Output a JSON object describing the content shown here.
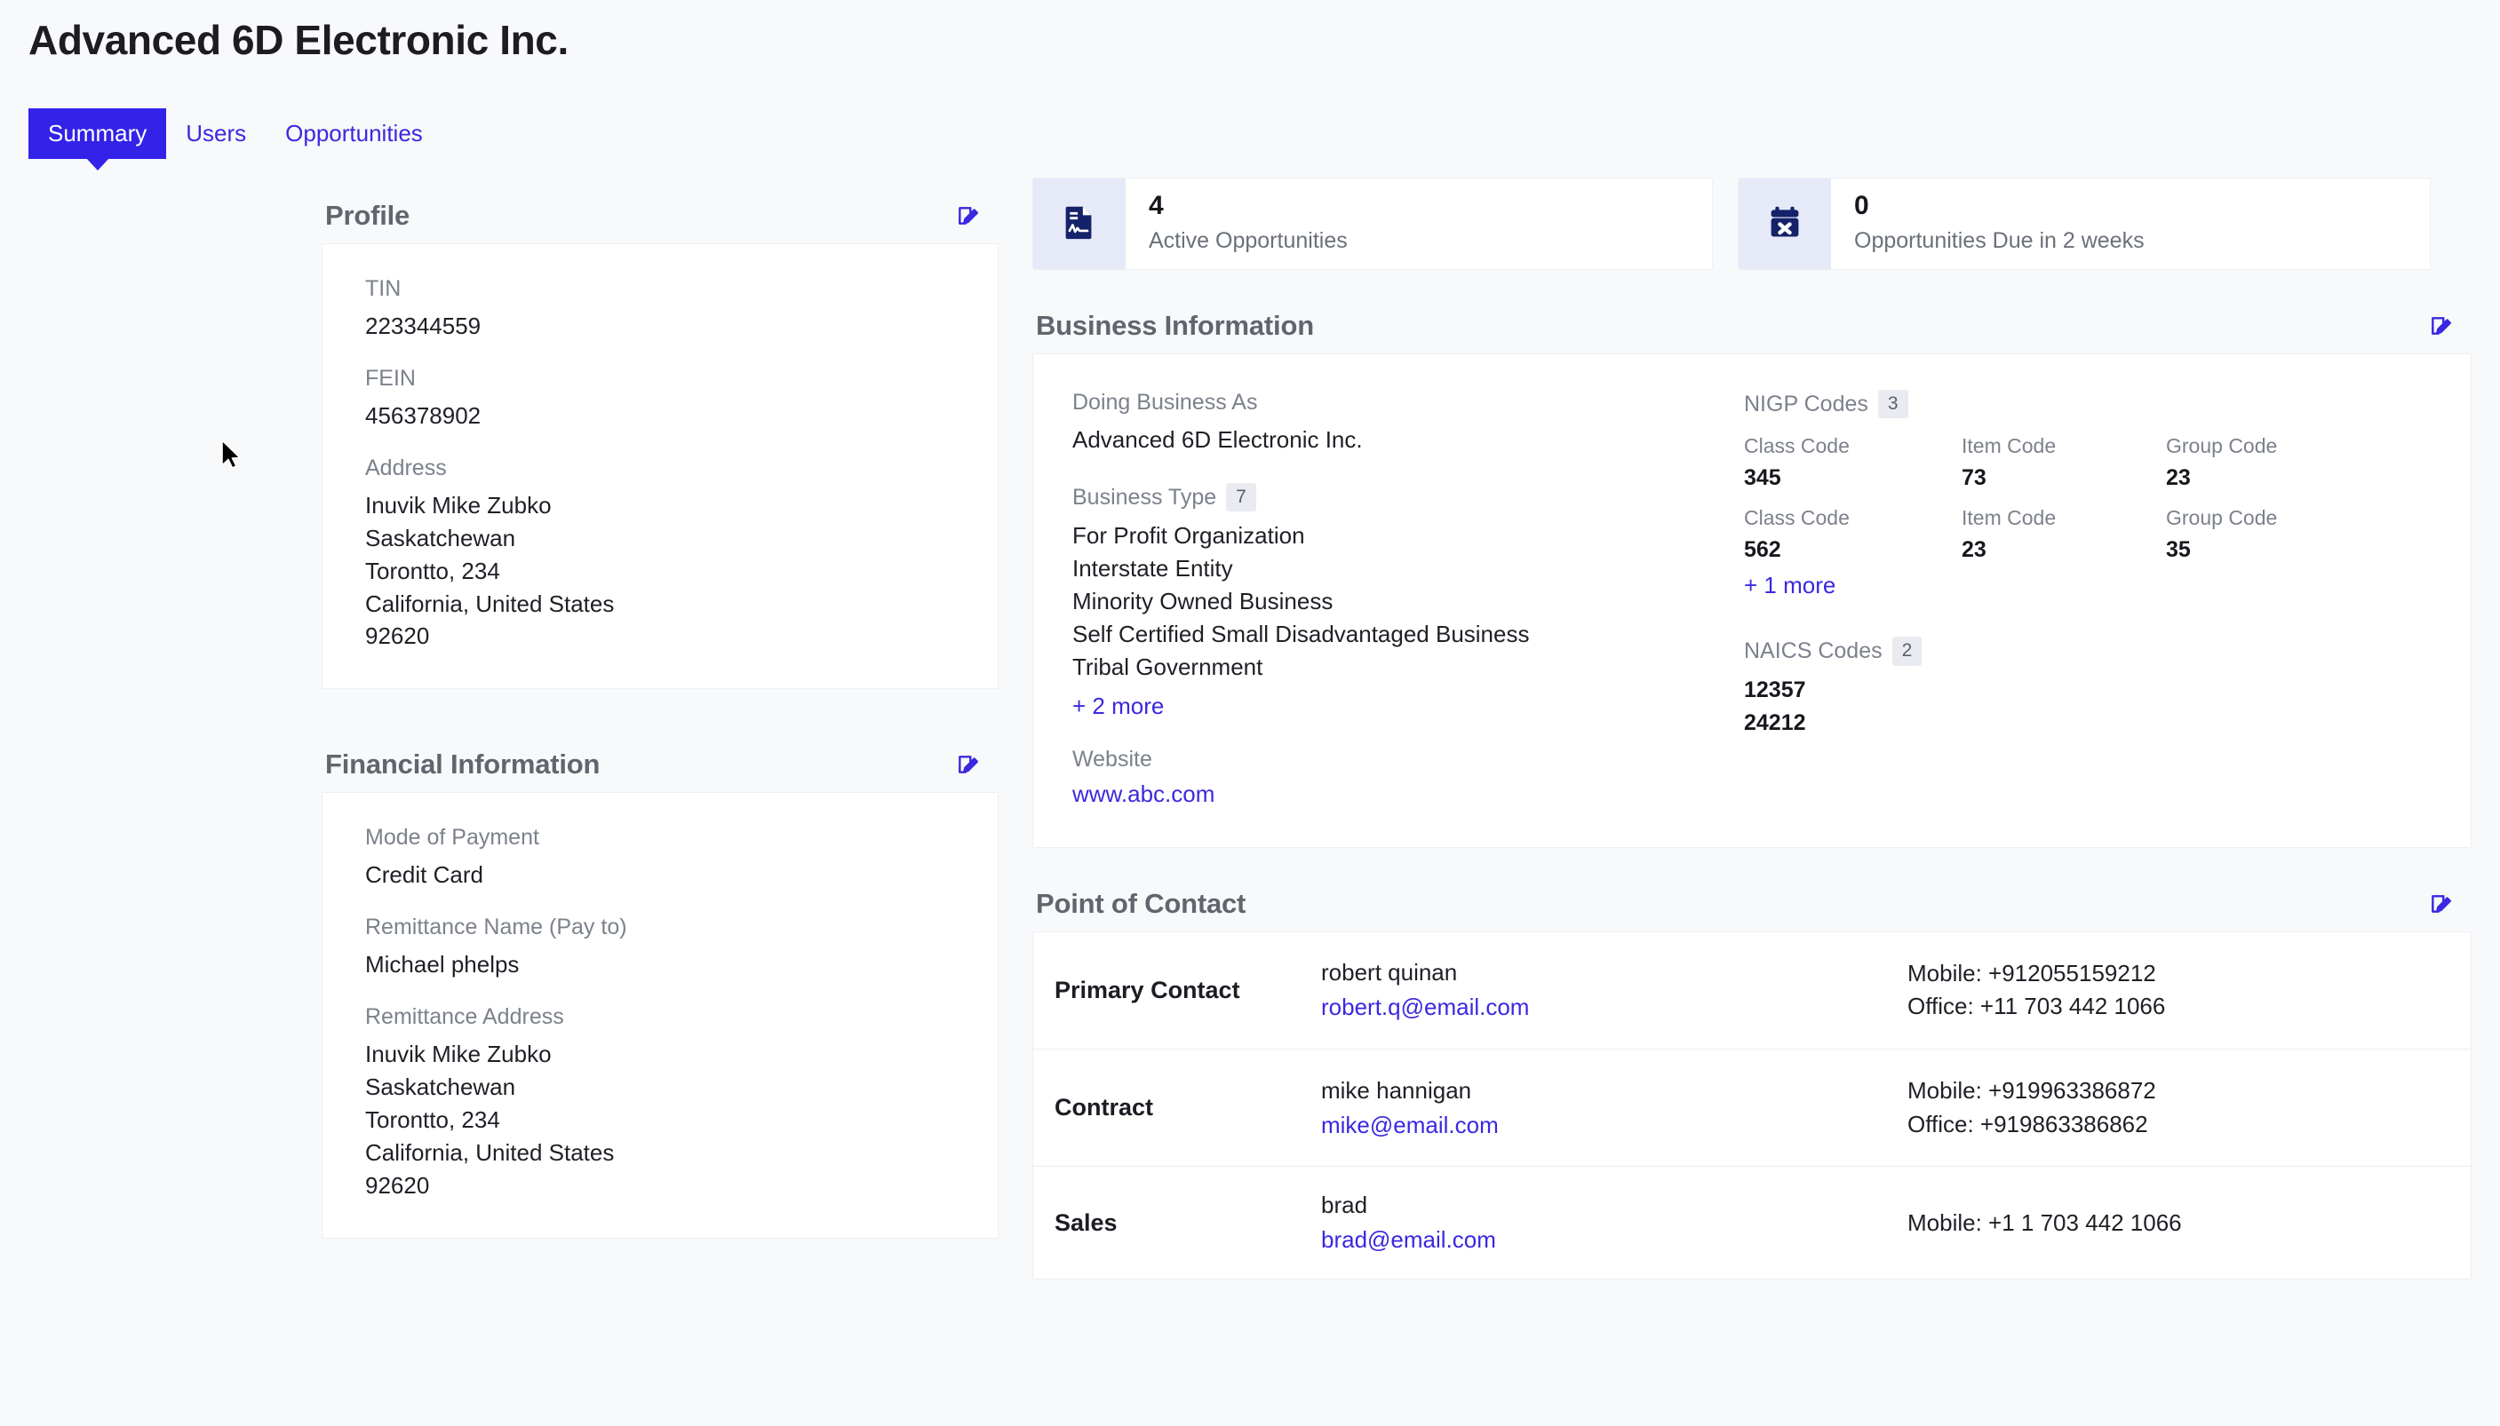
{
  "page": {
    "title": "Advanced 6D Electronic Inc."
  },
  "tabs": [
    {
      "label": "Summary",
      "active": true
    },
    {
      "label": "Users",
      "active": false
    },
    {
      "label": "Opportunities",
      "active": false
    }
  ],
  "colors": {
    "accent": "#3322E8",
    "link": "#3B28E0",
    "icon_navy": "#152269",
    "icon_bg": "#E6EAF8",
    "page_bg": "#F8F9FB",
    "card_bg": "#FFFFFF",
    "label_gray": "#7C818C",
    "heading_gray": "#61656E"
  },
  "profile": {
    "heading": "Profile",
    "edit_icon": "edit-pencil-icon",
    "fields": [
      {
        "label": "TIN",
        "value": "223344559"
      },
      {
        "label": "FEIN",
        "value": "456378902"
      },
      {
        "label": "Address",
        "value": "Inuvik Mike Zubko\nSaskatchewan\nTorontto, 234\nCalifornia, United States\n92620"
      }
    ]
  },
  "financial": {
    "heading": "Financial Information",
    "edit_icon": "edit-pencil-icon",
    "fields": [
      {
        "label": "Mode of Payment",
        "value": "Credit Card"
      },
      {
        "label": "Remittance Name (Pay to)",
        "value": "Michael phelps"
      },
      {
        "label": "Remittance Address",
        "value": "Inuvik Mike Zubko\nSaskatchewan\nTorontto, 234\nCalifornia, United States\n92620"
      }
    ]
  },
  "stats": [
    {
      "icon": "document-pulse-icon",
      "value": "4",
      "caption": "Active Opportunities"
    },
    {
      "icon": "calendar-x-icon",
      "value": "0",
      "caption": "Opportunities Due in 2 weeks"
    }
  ],
  "business": {
    "heading": "Business Information",
    "edit_icon": "edit-pencil-icon",
    "dba_label": "Doing Business As",
    "dba_value": "Advanced 6D Electronic Inc.",
    "business_type_label": "Business Type",
    "business_type_count": "7",
    "business_types": [
      "For Profit Organization",
      "Interstate Entity",
      "Minority Owned Business",
      "Self Certified Small Disadvantaged Business",
      "Tribal Government"
    ],
    "business_types_more": "+ 2 more",
    "website_label": "Website",
    "website_value": "www.abc.com",
    "nigp": {
      "label": "NIGP Codes",
      "count": "3",
      "col_labels": {
        "class": "Class Code",
        "item": "Item Code",
        "group": "Group Code"
      },
      "rows": [
        {
          "class": "345",
          "item": "73",
          "group": "23"
        },
        {
          "class": "562",
          "item": "23",
          "group": "35"
        }
      ],
      "more": "+ 1 more"
    },
    "naics": {
      "label": "NAICS Codes",
      "count": "2",
      "values": "12357\n24212"
    }
  },
  "contacts": {
    "heading": "Point of Contact",
    "edit_icon": "edit-pencil-icon",
    "rows": [
      {
        "role": "Primary Contact",
        "name": "robert quinan",
        "email": "robert.q@email.com",
        "phones": "Mobile: +912055159212\nOffice: +11 703 442 1066"
      },
      {
        "role": "Contract",
        "name": "mike hannigan",
        "email": "mike@email.com",
        "phones": "Mobile: +919963386872\nOffice: +919863386862"
      },
      {
        "role": "Sales",
        "name": "brad",
        "email": "brad@email.com",
        "phones": "Mobile: +1 1 703 442 1066"
      }
    ]
  }
}
